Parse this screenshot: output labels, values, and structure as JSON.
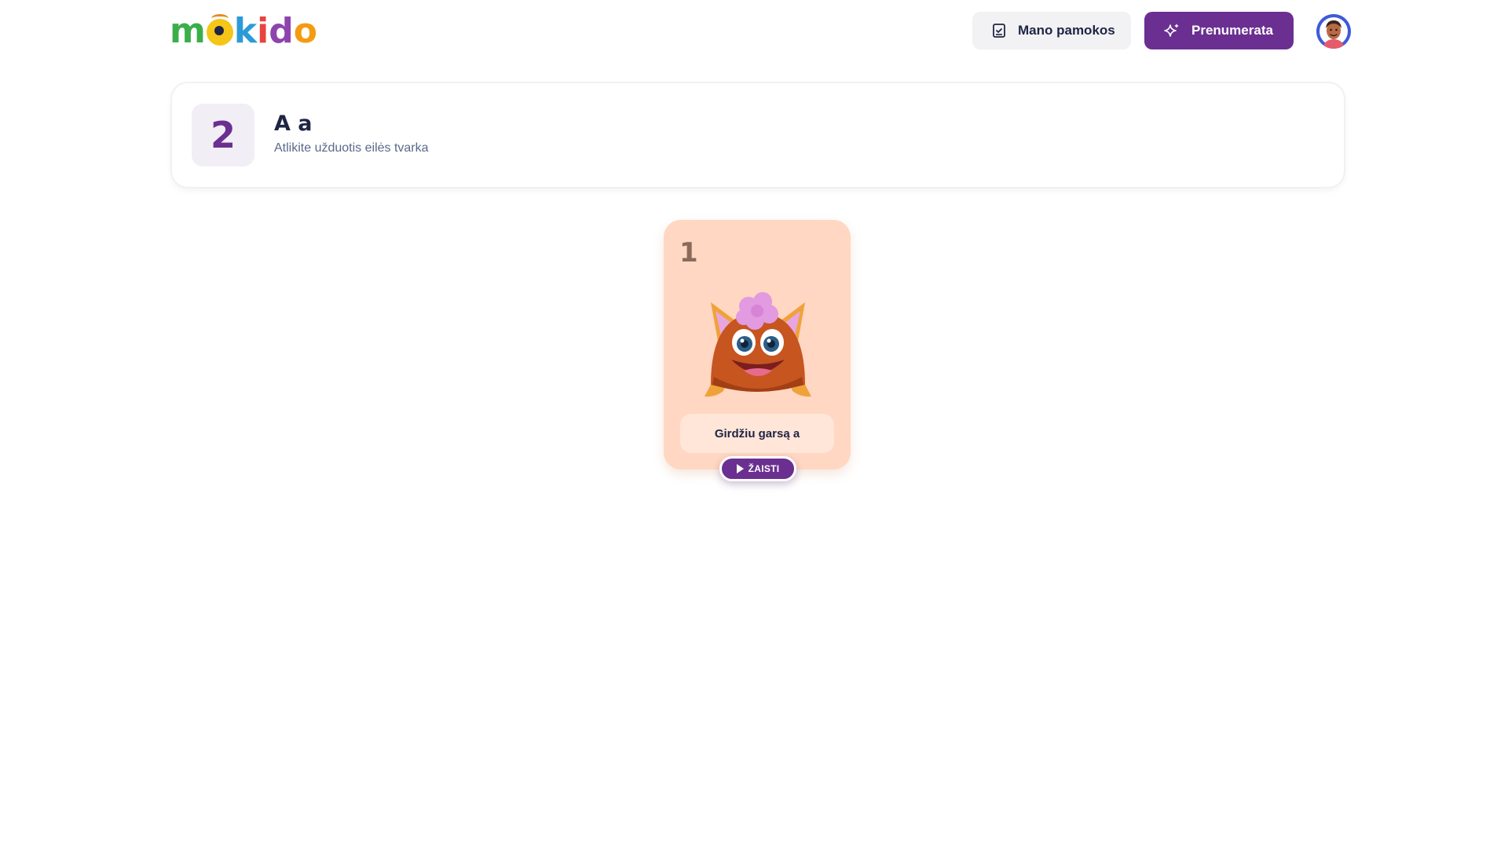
{
  "header": {
    "logo_text": "mokido",
    "lessons_button_label": "Mano pamokos",
    "lessons_icon": "checklist-book-icon",
    "subscribe_button_label": "Prenumerata",
    "subscribe_icon": "sparkles-icon",
    "avatar_icon": "user-avatar"
  },
  "lesson": {
    "number": "2",
    "title": "A a",
    "subtitle": "Atlikite užduotis eilės tvarka"
  },
  "exercises": [
    {
      "number": "1",
      "label": "Girdžiu garsą a",
      "image": "monster-character",
      "play_label": "ŽAISTI"
    }
  ],
  "colors": {
    "accent": "#6b2f91",
    "card_bg": "#ffd7c2",
    "text_dark": "#1f2544",
    "text_muted": "#5b6a8a"
  }
}
